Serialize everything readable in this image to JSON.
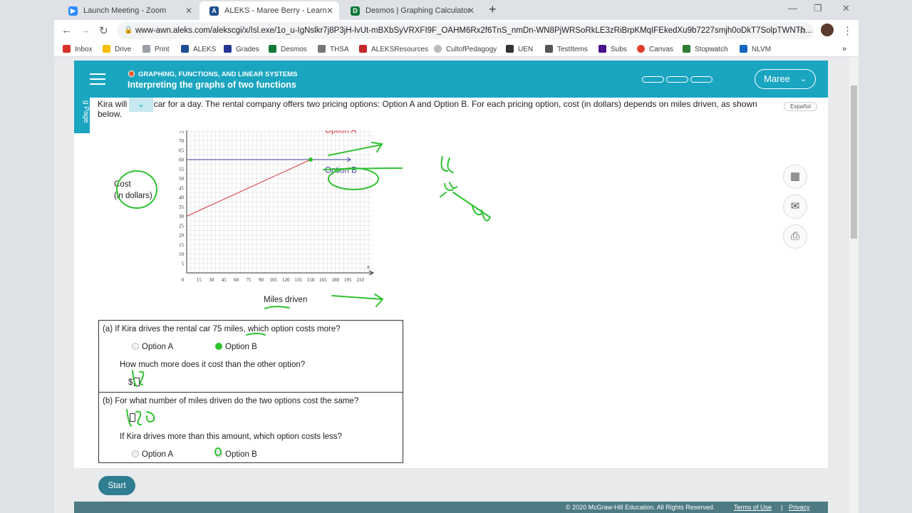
{
  "tabs": [
    {
      "title": "Launch Meeting - Zoom",
      "icon": "zoom-icon",
      "color": "#2d8cff"
    },
    {
      "title": "ALEKS - Maree Berry - Learn",
      "icon": "aleks-icon",
      "color": "#1d4f91"
    },
    {
      "title": "Desmos | Graphing Calculator",
      "icon": "desmos-icon",
      "color": "#127a38"
    }
  ],
  "address": {
    "url": "www-awn.aleks.com/alekscgi/x/Isl.exe/1o_u-IgNslkr7j8P3jH-lvUt-mBXbSyVRXFI9F_OAHM6Rx2f6TnS_nmDn-WN8PjWRSoRkLE3zRiBrpKMqIFEkedXu9b7227smjh0oDkT7SolpTWNTh..."
  },
  "bookmarks": [
    "Inbox",
    "Drive",
    "Print",
    "ALEKS",
    "Grades",
    "Desmos",
    "THSA",
    "ALEKSResources",
    "CultofPedagogy",
    "UEN",
    "TestItems",
    "Subs",
    "Canvas",
    "Stopwatch",
    "NLVM"
  ],
  "header": {
    "topic": "GRAPHING, FUNCTIONS, AND LINEAR SYSTEMS",
    "lesson": "Interpreting the graphs of two functions",
    "user": "Maree"
  },
  "side_tab": "g Page",
  "espanol": "Español",
  "problem": {
    "intro": "Kira will rent a car for a day. The rental company offers two pricing options: Option A and Option B. For each pricing option, cost (in dollars) depends on miles driven, as shown below."
  },
  "chart_data": {
    "type": "line",
    "xlabel": "Miles driven",
    "ylabel_line1": "Cost",
    "ylabel_line2": "(in dollars)",
    "xlim": [
      0,
      225
    ],
    "ylim": [
      0,
      80
    ],
    "x_ticks": [
      15,
      30,
      45,
      60,
      75,
      90,
      105,
      120,
      135,
      150,
      165,
      180,
      195,
      210
    ],
    "y_ticks": [
      5,
      10,
      15,
      20,
      25,
      30,
      35,
      40,
      45,
      50,
      55,
      60,
      65,
      70,
      75
    ],
    "origin_label": "0",
    "x_axis_letter": "x",
    "y_axis_letter": "y",
    "series": [
      {
        "name": "Option A",
        "color": "#d9363e",
        "x": [
          0,
          150
        ],
        "y": [
          30,
          60
        ]
      },
      {
        "name": "Option B",
        "color": "#3a3f9a",
        "x": [
          0,
          150
        ],
        "y": [
          60,
          60
        ]
      }
    ]
  },
  "questions": {
    "a_prompt": "(a)  If Kira drives the rental car 75 miles, which option costs more?",
    "a_opt1": "Option A",
    "a_opt2": "Option B",
    "a_followup": "How much more does it cost than the other option?",
    "a_dollar": "$",
    "b_prompt": "(b)  For what number of miles driven do the two options cost the same?",
    "b_followup": "If Kira drives more than this amount, which option costs less?",
    "b_opt1": "Option A",
    "b_opt2": "Option B"
  },
  "start": "Start",
  "footer": {
    "copyright": "© 2020 McGraw-Hill Education. All Rights Reserved.",
    "terms": "Terms of Use",
    "sep": "|",
    "privacy": "Privacy"
  },
  "colors": {
    "teal": "#1aa5c0",
    "ink": "#2fc22f"
  }
}
